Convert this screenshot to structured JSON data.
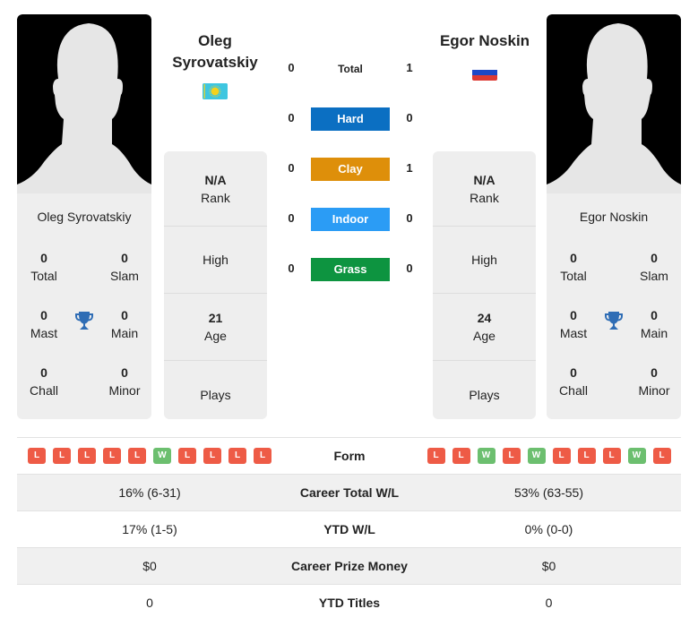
{
  "colors": {
    "hard": "#0b6fc2",
    "clay": "#de8f0a",
    "indoor": "#2b9cf5",
    "grass": "#0d9440",
    "loss": "#ee5b46",
    "win": "#6cbf6f",
    "trophy": "#2f6db5"
  },
  "player1": {
    "name_line1": "Oleg",
    "name_line2": "Syrovatskiy",
    "card_name": "Oleg Syrovatskiy",
    "flag": "kazakhstan-flag",
    "titles": {
      "total": {
        "value": "0",
        "label": "Total"
      },
      "slam": {
        "value": "0",
        "label": "Slam"
      },
      "mast": {
        "value": "0",
        "label": "Mast"
      },
      "main": {
        "value": "0",
        "label": "Main"
      },
      "chall": {
        "value": "0",
        "label": "Chall"
      },
      "minor": {
        "value": "0",
        "label": "Minor"
      }
    },
    "info": {
      "rank_value": "N/A",
      "rank_label": "Rank",
      "high_label": "High",
      "age_value": "21",
      "age_label": "Age",
      "plays_label": "Plays"
    },
    "form": [
      "L",
      "L",
      "L",
      "L",
      "L",
      "W",
      "L",
      "L",
      "L",
      "L"
    ]
  },
  "player2": {
    "name": "Egor Noskin",
    "card_name": "Egor Noskin",
    "flag": "russia-flag",
    "titles": {
      "total": {
        "value": "0",
        "label": "Total"
      },
      "slam": {
        "value": "0",
        "label": "Slam"
      },
      "mast": {
        "value": "0",
        "label": "Mast"
      },
      "main": {
        "value": "0",
        "label": "Main"
      },
      "chall": {
        "value": "0",
        "label": "Chall"
      },
      "minor": {
        "value": "0",
        "label": "Minor"
      }
    },
    "info": {
      "rank_value": "N/A",
      "rank_label": "Rank",
      "high_label": "High",
      "age_value": "24",
      "age_label": "Age",
      "plays_label": "Plays"
    },
    "form": [
      "L",
      "L",
      "W",
      "L",
      "W",
      "L",
      "L",
      "L",
      "W",
      "L"
    ]
  },
  "h2h": [
    {
      "label": "Total",
      "p1": "0",
      "p2": "1",
      "surface": "total"
    },
    {
      "label": "Hard",
      "p1": "0",
      "p2": "0",
      "surface": "hard"
    },
    {
      "label": "Clay",
      "p1": "0",
      "p2": "1",
      "surface": "clay"
    },
    {
      "label": "Indoor",
      "p1": "0",
      "p2": "0",
      "surface": "indoor"
    },
    {
      "label": "Grass",
      "p1": "0",
      "p2": "0",
      "surface": "grass"
    }
  ],
  "stats": {
    "form_label": "Form",
    "rows": [
      {
        "label": "Career Total W/L",
        "p1": "16% (6-31)",
        "p2": "53% (63-55)"
      },
      {
        "label": "YTD W/L",
        "p1": "17% (1-5)",
        "p2": "0% (0-0)"
      },
      {
        "label": "Career Prize Money",
        "p1": "$0",
        "p2": "$0"
      },
      {
        "label": "YTD Titles",
        "p1": "0",
        "p2": "0"
      }
    ]
  }
}
